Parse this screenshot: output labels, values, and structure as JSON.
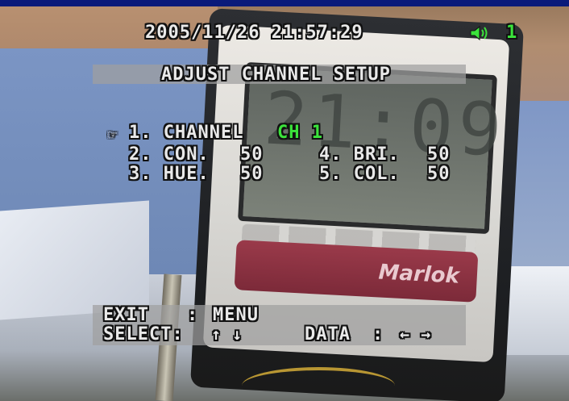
{
  "osd": {
    "datetime": "2005/11/26 21:57:29",
    "speaker_icon": "speaker-icon",
    "channel_indicator": "1",
    "title": "ADJUST CHANNEL SETUP",
    "cursor": "☞",
    "items": [
      {
        "label": "1. CHANNEL",
        "value": "CH 1"
      },
      {
        "label": "2. CON.",
        "value": "50"
      },
      {
        "label": "3. HUE.",
        "value": "50"
      },
      {
        "label": "4. BRI.",
        "value": "50"
      },
      {
        "label": "5. COL.",
        "value": "50"
      }
    ],
    "footer": {
      "exit_key": "EXIT",
      "exit_sep": ":",
      "exit_value": "MENU",
      "select_key": "SELECT:",
      "select_arrows": "↑ ↓",
      "data_key": "DATA",
      "data_sep": ":",
      "data_arrows": "← →"
    }
  },
  "scene": {
    "clock_digits": "21:09",
    "clock_brand": "Marlok"
  },
  "colors": {
    "osd_text": "#e9e9e9",
    "osd_highlight": "#3be33b",
    "osd_band": "#a0a0a0"
  }
}
